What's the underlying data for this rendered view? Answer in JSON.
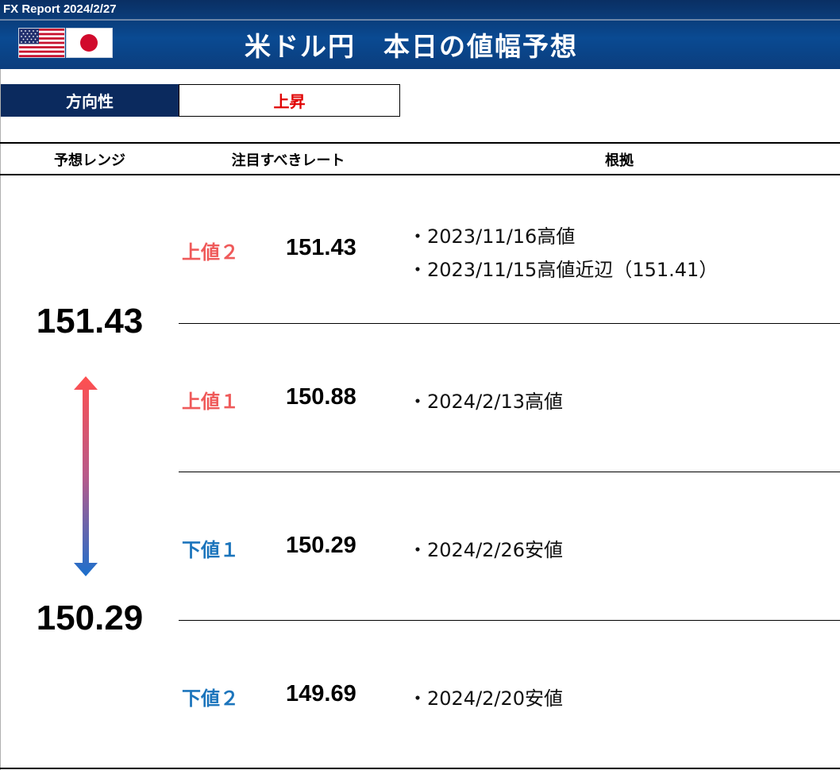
{
  "header": {
    "report_label": "FX Report 2024/2/27",
    "title": "米ドル円　本日の値幅予想",
    "flags": [
      "us-flag-icon",
      "jp-flag-icon"
    ]
  },
  "direction": {
    "label": "方向性",
    "value": "上昇",
    "value_color": "#e00000"
  },
  "columns": {
    "range": "予想レンジ",
    "rate": "注目すべきレート",
    "basis": "根拠"
  },
  "range": {
    "high": "151.43",
    "low": "150.29",
    "arrow_icon": "double-arrow-vertical-icon"
  },
  "levels": [
    {
      "label": "上値２",
      "rate": "151.43",
      "basis": [
        "・2023/11/16高値",
        "・2023/11/15高値近辺（151.41）"
      ]
    },
    {
      "label": "上値１",
      "rate": "150.88",
      "basis": [
        "・2024/2/13高値"
      ]
    },
    {
      "label": "下値１",
      "rate": "150.29",
      "basis": [
        "・2024/2/26安値"
      ]
    },
    {
      "label": "下値２",
      "rate": "149.69",
      "basis": [
        "・2024/2/20安値"
      ]
    }
  ],
  "colors": {
    "header_bg": "#0a4a92",
    "upper_level": "#ef5a5a",
    "lower_level": "#1c75bc"
  }
}
